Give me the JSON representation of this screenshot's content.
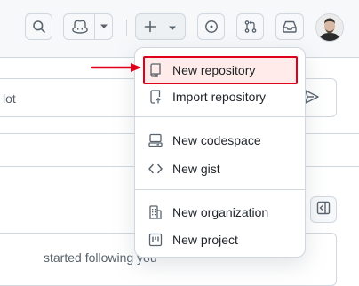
{
  "header": {
    "icons": [
      "search-icon",
      "copilot-icon",
      "triangle-down-icon",
      "plus-icon",
      "issue-opened-icon",
      "git-pull-request-icon",
      "inbox-icon"
    ]
  },
  "background": {
    "input_text": "lot",
    "activity_text": "started following you"
  },
  "menu": {
    "items": [
      {
        "label": "New repository",
        "icon": "repo-icon",
        "highlighted": true
      },
      {
        "label": "Import repository",
        "icon": "repo-push-icon"
      },
      {
        "label": "New codespace",
        "icon": "codespaces-icon"
      },
      {
        "label": "New gist",
        "icon": "code-icon"
      },
      {
        "label": "New organization",
        "icon": "organization-icon"
      },
      {
        "label": "New project",
        "icon": "project-icon"
      }
    ]
  },
  "colors": {
    "highlight_border": "#e0001b",
    "arrow": "#e0001b",
    "border": "#d0d7de",
    "header_bg": "#f6f8fa"
  }
}
